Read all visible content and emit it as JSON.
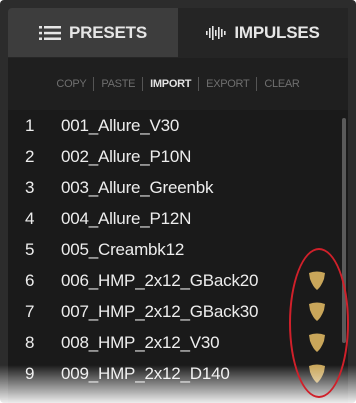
{
  "tabs": {
    "presets": "PRESETS",
    "impulses": "IMPULSES"
  },
  "toolbar": {
    "copy": "COPY",
    "paste": "PASTE",
    "import": "IMPORT",
    "export": "EXPORT",
    "clear": "CLEAR"
  },
  "impulses": [
    {
      "num": "1",
      "name": "001_Allure_V30",
      "marked": false
    },
    {
      "num": "2",
      "name": "002_Allure_P10N",
      "marked": false
    },
    {
      "num": "3",
      "name": "003_Allure_Greenbk",
      "marked": false
    },
    {
      "num": "4",
      "name": "004_Allure_P12N",
      "marked": false
    },
    {
      "num": "5",
      "name": "005_Creambk12",
      "marked": false
    },
    {
      "num": "6",
      "name": "006_HMP_2x12_GBack20",
      "marked": true
    },
    {
      "num": "7",
      "name": "007_HMP_2x12_GBack30",
      "marked": true
    },
    {
      "num": "8",
      "name": "008_HMP_2x12_V30",
      "marked": true
    },
    {
      "num": "9",
      "name": "009_HMP_2x12_D140",
      "marked": true
    }
  ],
  "colors": {
    "marker": "#c9a65a",
    "callout": "#d0202a",
    "panel": "#2c2c2c"
  },
  "icons": {
    "presets": "list-icon",
    "impulses": "waveform-icon",
    "marker": "shield-icon"
  }
}
